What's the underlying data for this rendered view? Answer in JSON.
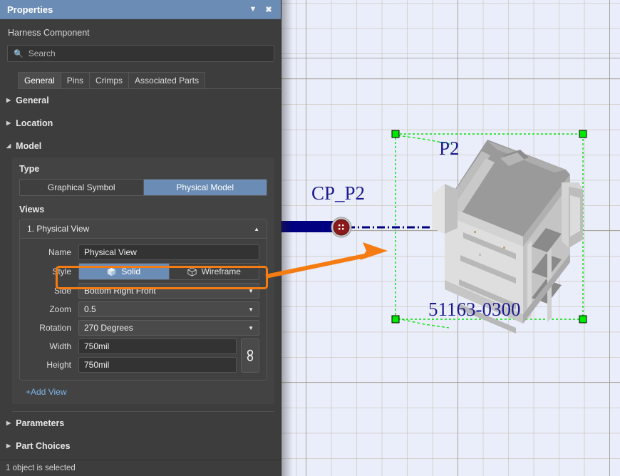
{
  "window": {
    "title": "Properties",
    "menu_icon": "chevron-down-icon",
    "close_icon": "close-icon",
    "subtitle": "Harness Component"
  },
  "search": {
    "placeholder": "Search",
    "value": "",
    "icon": "search-icon"
  },
  "tabs": [
    {
      "label": "General",
      "active": true
    },
    {
      "label": "Pins",
      "active": false
    },
    {
      "label": "Crimps",
      "active": false
    },
    {
      "label": "Associated Parts",
      "active": false
    }
  ],
  "sections": {
    "general": {
      "label": "General",
      "expanded": false,
      "tri": "▶"
    },
    "location": {
      "label": "Location",
      "expanded": false,
      "tri": "▶"
    },
    "model": {
      "label": "Model",
      "expanded": true,
      "tri": "◢"
    },
    "parameters": {
      "label": "Parameters",
      "expanded": false,
      "tri": "▶"
    },
    "part_choices": {
      "label": "Part Choices",
      "expanded": false,
      "tri": "▶"
    }
  },
  "model": {
    "type_label": "Type",
    "type_options": [
      {
        "label": "Graphical Symbol",
        "selected": false
      },
      {
        "label": "Physical Model",
        "selected": true
      }
    ],
    "views_label": "Views",
    "view": {
      "header": "1. Physical View",
      "collapse_icon": "chevron-up-icon",
      "fields": {
        "name": {
          "label": "Name",
          "value": "Physical View"
        },
        "style": {
          "label": "Style",
          "options": [
            {
              "label": "Solid",
              "icon": "cube-solid-icon",
              "selected": true
            },
            {
              "label": "Wireframe",
              "icon": "cube-wireframe-icon",
              "selected": false
            }
          ]
        },
        "side": {
          "label": "Side",
          "value": "Bottom Right Front",
          "highlighted": true
        },
        "zoom": {
          "label": "Zoom",
          "value": "0.5"
        },
        "rotation": {
          "label": "Rotation",
          "value": "270 Degrees"
        },
        "width": {
          "label": "Width",
          "value": "750mil"
        },
        "height": {
          "label": "Height",
          "value": "750mil"
        },
        "link_icon": "chain-link-icon"
      }
    },
    "add_view": "+Add View"
  },
  "statusbar": {
    "text": "1 object is selected"
  },
  "canvas": {
    "component_designator": "P2",
    "connection_point_label": "CP_P2",
    "part_number": "51163-0300",
    "selection_handles": 4,
    "colors": {
      "background": "#eaeefb",
      "grid_line": "#c4beaa",
      "selection_green": "#00e000",
      "wire_navy": "#000080",
      "connector_red": "#8b1a1a",
      "annotation_orange": "#f57c12",
      "panel_accent": "#6b8db5"
    }
  }
}
